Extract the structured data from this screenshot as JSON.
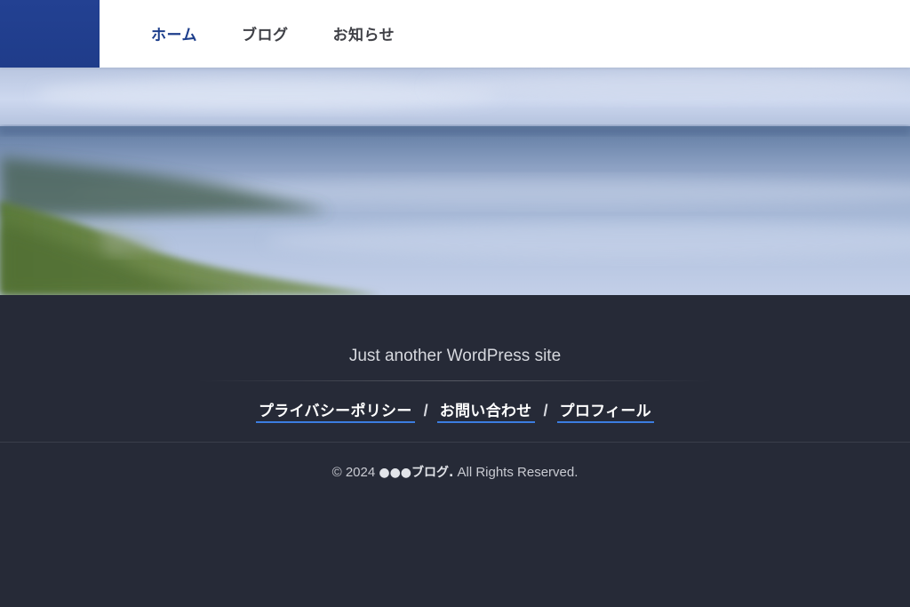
{
  "header": {
    "nav": [
      {
        "label": "ホーム",
        "active": true
      },
      {
        "label": "ブログ",
        "active": false
      },
      {
        "label": "お知らせ",
        "active": false
      }
    ]
  },
  "hero": {
    "image": "blurred-coastline-landscape"
  },
  "footer": {
    "tagline": "Just another WordPress site",
    "links": [
      {
        "label": "プライバシーポリシー"
      },
      {
        "label": "お問い合わせ"
      },
      {
        "label": "プロフィール"
      }
    ],
    "separator": "/",
    "copyright_prefix": "© 2024",
    "site_name": "●●●ブログ.",
    "copyright_suffix": "All Rights Reserved."
  },
  "colors": {
    "brand_blue": "#1e3f8c",
    "footer_bg": "#262a37",
    "link_underline": "#3b7de0"
  }
}
